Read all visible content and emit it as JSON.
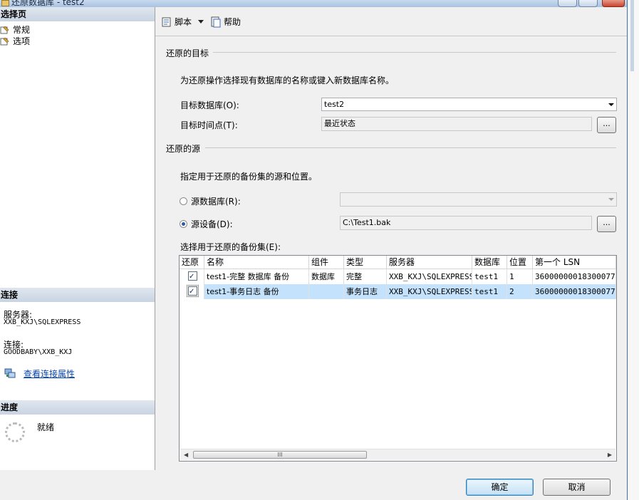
{
  "window": {
    "title": "还原数据库 - test2"
  },
  "left": {
    "select_page_header": "选择页",
    "nav": [
      {
        "label": "常规"
      },
      {
        "label": "选项"
      }
    ],
    "connection_header": "连接",
    "server_label": "服务器:",
    "server_value": "XXB_KXJ\\SQLEXPRESS",
    "connection_label": "连接:",
    "connection_value": "GOODBABY\\XXB_KXJ",
    "view_conn_props_link": "查看连接属性",
    "progress_header": "进度",
    "progress_status": "就绪"
  },
  "toolbar": {
    "script_label": "脚本",
    "help_label": "帮助"
  },
  "target": {
    "group_title": "还原的目标",
    "description": "为还原操作选择现有数据库的名称或键入新数据库名称。",
    "db_label": "目标数据库(O):",
    "db_value": "test2",
    "time_label": "目标时间点(T):",
    "time_value": "最近状态",
    "ellipsis": "..."
  },
  "source": {
    "group_title": "还原的源",
    "description": "指定用于还原的备份集的源和位置。",
    "from_db_label": "源数据库(R):",
    "from_db_value": "",
    "from_device_label": "源设备(D):",
    "from_device_value": "C:\\Test1.bak",
    "selected_option": "源设备(D):",
    "ellipsis": "..."
  },
  "backup_sets": {
    "label": "选择用于还原的备份集(E):",
    "columns": [
      "还原",
      "名称",
      "组件",
      "类型",
      "服务器",
      "数据库",
      "位置",
      "第一个 LSN"
    ],
    "rows": [
      {
        "restore": true,
        "name": "test1-完整 数据库 备份",
        "component": "数据库",
        "type": "完整",
        "server": "XXB_KXJ\\SQLEXPRESS",
        "database": "test1",
        "position": "1",
        "first_lsn": "36000000018300077",
        "selected": false
      },
      {
        "restore": true,
        "name": "test1-事务日志  备份",
        "component": "",
        "type": "事务日志",
        "server": "XXB_KXJ\\SQLEXPRESS",
        "database": "test1",
        "position": "2",
        "first_lsn": "36000000018300077",
        "selected": true
      }
    ]
  },
  "buttons": {
    "ok": "确定",
    "cancel": "取消"
  },
  "colors": {
    "selected_row": "#c4e2fb",
    "header_band": "#cdd7e4",
    "link": "#0645ad"
  }
}
